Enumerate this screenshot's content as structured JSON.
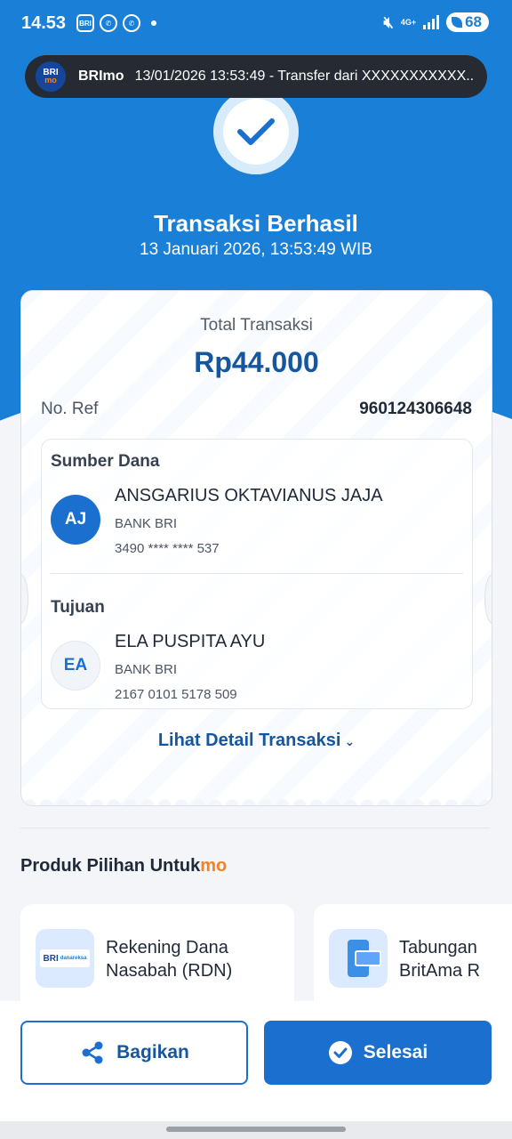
{
  "status_bar": {
    "time": "14.53",
    "app_icons": [
      "brimo-icon",
      "whatsapp-icon",
      "whatsapp-icon"
    ],
    "network": "4G+",
    "battery": "68"
  },
  "notification": {
    "app": "BRImo",
    "text": "13/01/2026 13:53:49 -  Transfer dari XXXXXXXXXXX..."
  },
  "result": {
    "title": "Transaksi Berhasil",
    "datetime": "13 Januari 2026, 13:53:49 WIB"
  },
  "receipt": {
    "total_label": "Total Transaksi",
    "total_amount": "Rp44.000",
    "ref_label": "No. Ref",
    "ref_value": "960124306648",
    "source": {
      "section_title": "Sumber Dana",
      "initials": "AJ",
      "name": "ANSGARIUS OKTAVIANUS JAJA",
      "bank": "BANK BRI",
      "account": "3490 **** **** 537"
    },
    "destination": {
      "section_title": "Tujuan",
      "initials": "EA",
      "name": "ELA PUSPITA AYU",
      "bank": "BANK BRI",
      "account": "2167 0101 5178 509"
    },
    "detail_link": "Lihat Detail Transaksi"
  },
  "products": {
    "title": "Produk Pilihan Untuk",
    "title_accent": "mo",
    "items": [
      {
        "line1": "Rekening Dana",
        "line2": "Nasabah (RDN)",
        "icon": "bri-danareksa-icon"
      },
      {
        "line1": "Tabungan",
        "line2": "BritAma R",
        "icon": "phone-card-icon"
      }
    ]
  },
  "actions": {
    "share": "Bagikan",
    "done": "Selesai"
  },
  "colors": {
    "primary": "#1a7fd6",
    "dark_blue": "#15569e",
    "accent_orange": "#f58220"
  }
}
